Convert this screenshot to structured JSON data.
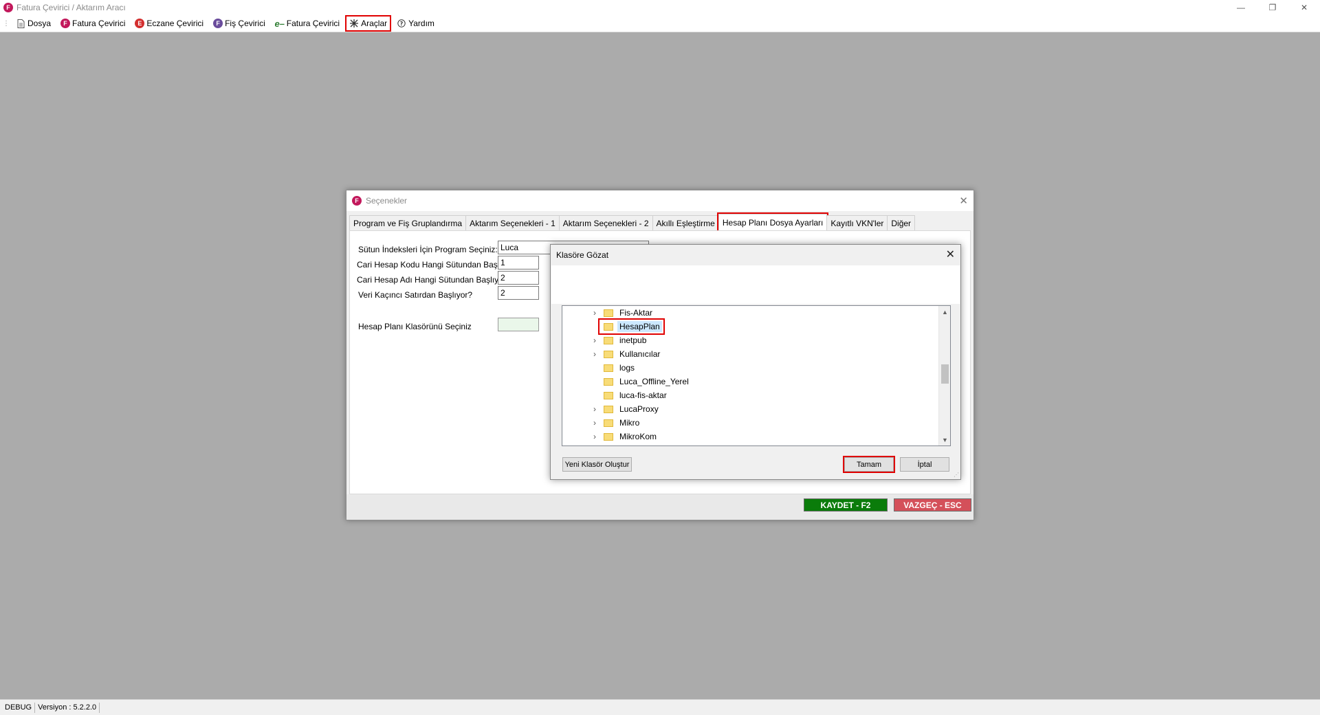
{
  "window": {
    "title": "Fatura Çevirici / Aktarım Aracı",
    "logo_letter": "F",
    "minimize": "—",
    "restore": "❐",
    "close": "✕"
  },
  "menu": {
    "dosya": "Dosya",
    "fatura": "Fatura Çevirici",
    "eczane": "Eczane Çevirici",
    "fis": "Fiş Çevirici",
    "efatura": "Fatura Çevirici",
    "araclar": "Araçlar",
    "yardim": "Yardım"
  },
  "dialog": {
    "title": "Seçenekler",
    "tabs": [
      "Program ve Fiş Gruplandırma",
      "Aktarım Seçenekleri - 1",
      "Aktarım Seçenekleri - 2",
      "Akıllı Eşleştirme",
      "Hesap Planı Dosya Ayarları",
      "Kayıtlı VKN'ler",
      "Diğer"
    ],
    "fields": {
      "program_label": "Sütun İndeksleri İçin Program Seçiniz:",
      "program_value": "Luca",
      "kod_label": "Cari Hesap Kodu Hangi Sütundan Başlıyor?",
      "kod_value": "1",
      "ad_label": "Cari Hesap Adı Hangi Sütundan Başlıyor?",
      "ad_value": "2",
      "satir_label": "Veri Kaçıncı Satırdan Başlıyor?",
      "satir_value": "2",
      "klasor_label": "Hesap Planı Klasörünü Seçiniz",
      "klasor_value": ""
    },
    "save_button": "KAYDET - F2",
    "cancel_button": "VAZGEÇ - ESC"
  },
  "browse": {
    "title": "Klasöre Gözat",
    "folders": [
      {
        "name": "Fis-Aktar",
        "expandable": true,
        "selected": false
      },
      {
        "name": "HesapPlan",
        "expandable": false,
        "selected": true
      },
      {
        "name": "inetpub",
        "expandable": true,
        "selected": false
      },
      {
        "name": "Kullanıcılar",
        "expandable": true,
        "selected": false
      },
      {
        "name": "logs",
        "expandable": false,
        "selected": false
      },
      {
        "name": "Luca_Offline_Yerel",
        "expandable": false,
        "selected": false
      },
      {
        "name": "luca-fis-aktar",
        "expandable": false,
        "selected": false
      },
      {
        "name": "LucaProxy",
        "expandable": true,
        "selected": false
      },
      {
        "name": "Mikro",
        "expandable": true,
        "selected": false
      },
      {
        "name": "MikroKom",
        "expandable": true,
        "selected": false
      }
    ],
    "new_folder_button": "Yeni Klasör Oluştur",
    "ok_button": "Tamam",
    "cancel_button": "İptal"
  },
  "status": {
    "mode": "DEBUG",
    "version": "Versiyon : 5.2.2.0"
  },
  "colors": {
    "highlight": "#e00000",
    "save": "#0a7c0a",
    "cancel": "#d4505a",
    "brand": "#c2185b"
  }
}
